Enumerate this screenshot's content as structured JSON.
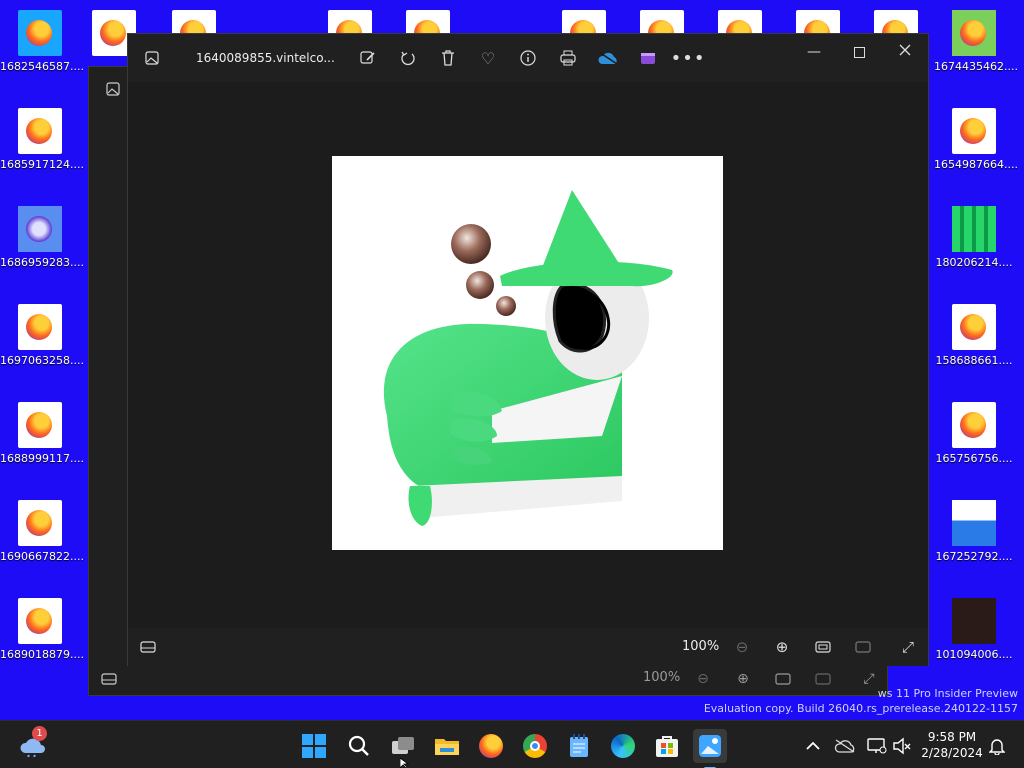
{
  "desktop": {
    "left_icons": [
      {
        "label": "1682546587...."
      },
      {
        "label": "1685917124...."
      },
      {
        "label": "1686959283...."
      },
      {
        "label": "1697063258...."
      },
      {
        "label": "1688999117...."
      },
      {
        "label": "1690667822...."
      },
      {
        "label": "1689018879...."
      }
    ],
    "right_icons": [
      {
        "label": "1674435462...."
      },
      {
        "label": "1654987664...."
      },
      {
        "label": "180206214...."
      },
      {
        "label": "158688661...."
      },
      {
        "label": "165756756...."
      },
      {
        "label": "167252792...."
      },
      {
        "label": "101094006...."
      }
    ],
    "watermark_line1": "ws 11 Pro Insider Preview",
    "watermark_line2": "Evaluation copy. Build 26040.rs_prerelease.240122-1157"
  },
  "photo_viewer": {
    "file_name": "1640089855.vintelco...",
    "zoom_level": "100%",
    "back_zoom_level": "100%"
  },
  "taskbar": {
    "time": "9:58 PM",
    "date": "2/28/2024",
    "weather_badge": "1"
  },
  "colors": {
    "desktop": "#1d0cf5",
    "window_bg": "#202020",
    "character_green": "#3fda74"
  }
}
